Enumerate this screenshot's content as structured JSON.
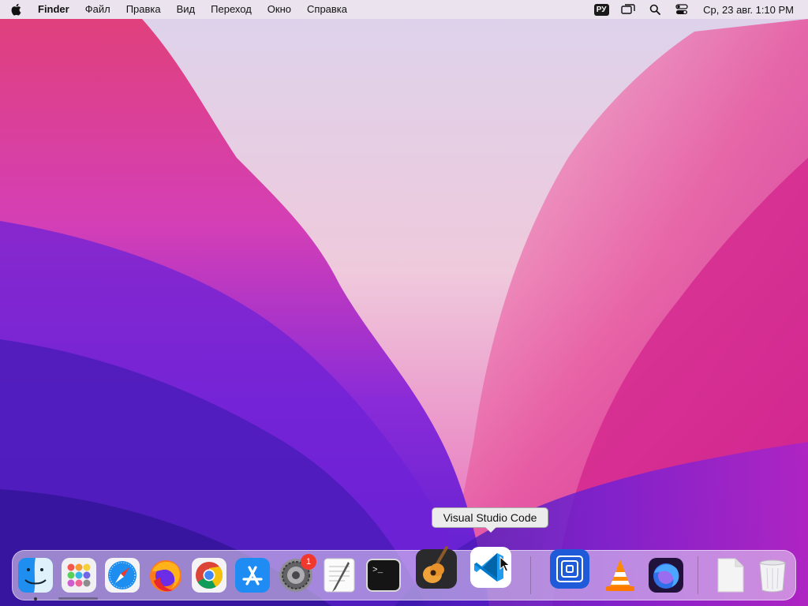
{
  "menubar": {
    "app_name": "Finder",
    "items": [
      "Файл",
      "Правка",
      "Вид",
      "Переход",
      "Окно",
      "Справка"
    ],
    "lang": "РУ",
    "clock": "Ср, 23 авг. 1:10 PM"
  },
  "tooltip": {
    "label": "Visual Studio Code"
  },
  "dock": {
    "apps": [
      {
        "icon": "finder-icon",
        "running": true
      },
      {
        "icon": "launchpad-icon"
      },
      {
        "icon": "safari-icon"
      },
      {
        "icon": "firefox-icon"
      },
      {
        "icon": "chrome-icon"
      },
      {
        "icon": "app-store-icon"
      },
      {
        "icon": "system-settings-icon",
        "badge": "1"
      },
      {
        "icon": "textedit-icon"
      },
      {
        "icon": "terminal-icon"
      },
      {
        "icon": "garageband-icon"
      },
      {
        "icon": "vscode-icon"
      },
      {
        "icon": "proxy-app-icon"
      },
      {
        "icon": "vlc-icon"
      },
      {
        "icon": "firefox-nightly-icon"
      },
      {
        "icon": "document-icon"
      },
      {
        "icon": "trash-icon"
      }
    ]
  },
  "colors": {
    "menubar_bg": "#ece4ee",
    "wallpaper_top": "#e8d8ec",
    "wallpaper_pink": "#e0389e",
    "wallpaper_purple": "#5a1fd0",
    "badge": "#f0382f"
  }
}
